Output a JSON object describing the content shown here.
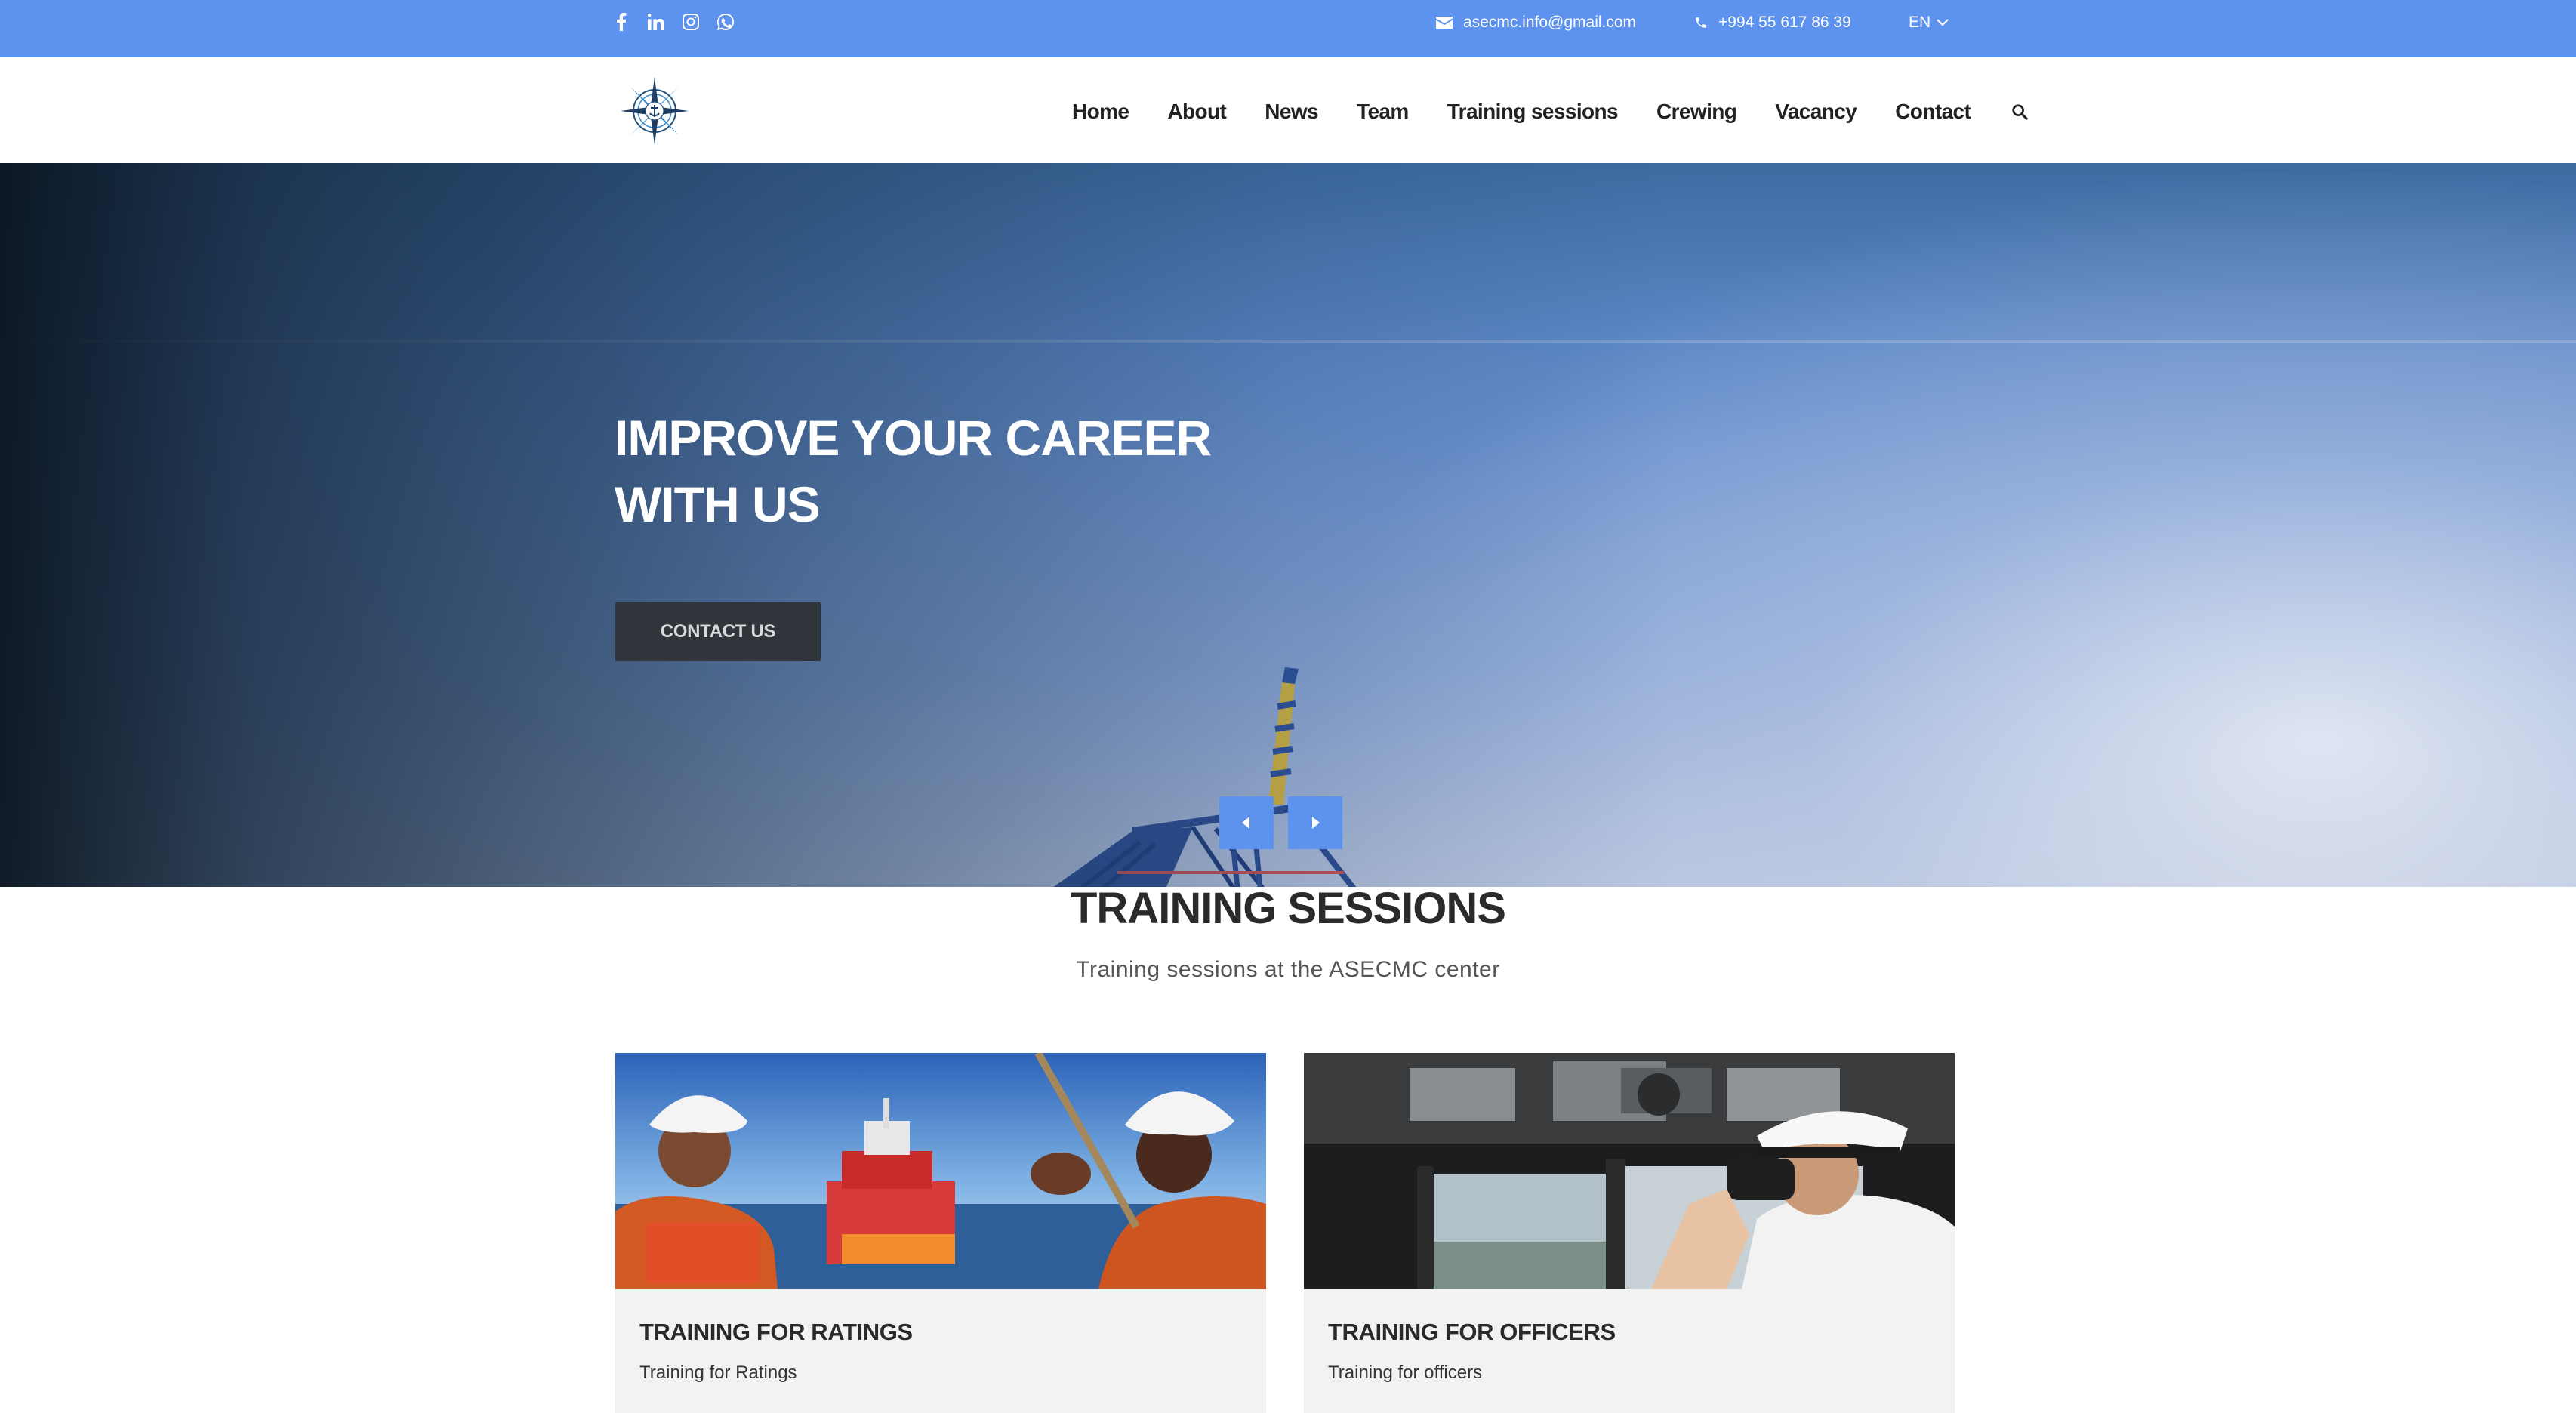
{
  "topbar": {
    "social": [
      "facebook-icon",
      "linkedin-icon",
      "instagram-icon",
      "whatsapp-icon"
    ],
    "email": "asecmc.info@gmail.com",
    "phone": "+994 55 617 86 39",
    "language": "EN",
    "background_color": "#5d93ef"
  },
  "nav": {
    "items": [
      "Home",
      "About",
      "News",
      "Team",
      "Training sessions",
      "Crewing",
      "Vacancy",
      "Contact"
    ]
  },
  "hero": {
    "title": "IMPROVE YOUR CAREER WITH US",
    "cta": "CONTACT US"
  },
  "training": {
    "title": "TRAINING SESSIONS",
    "subtitle": "Training sessions at the ASECMC center",
    "cards": [
      {
        "title": "TRAINING FOR RATINGS",
        "desc": "Training for Ratings"
      },
      {
        "title": "TRAINING FOR OFFICERS",
        "desc": "Training for officers"
      }
    ]
  },
  "colors": {
    "accent": "#5d93ef",
    "button_dark": "#2f353b"
  }
}
